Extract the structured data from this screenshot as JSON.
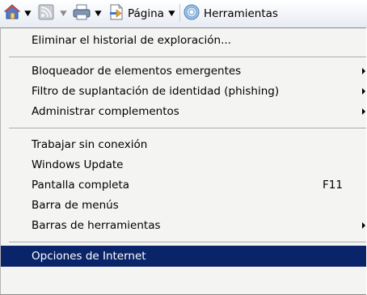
{
  "toolbar": {
    "home_icon": "home-icon",
    "feeds_icon": "feeds-icon",
    "print_icon": "print-icon",
    "page_label": "Página",
    "tools_label": "Herramientas",
    "colors": {
      "blue": "#3a6cc2",
      "orange": "#e38a1a",
      "highlight": "#0a246a"
    }
  },
  "menu": {
    "items": [
      {
        "label": "Eliminar el historial de exploración..."
      },
      {
        "label": "Bloqueador de elementos emergentes"
      },
      {
        "label": "Filtro de suplantación de identidad (phishing)"
      },
      {
        "label": "Administrar complementos"
      },
      {
        "label": "Trabajar sin conexión"
      },
      {
        "label": "Windows Update"
      },
      {
        "label": "Pantalla completa",
        "shortcut": "F11"
      },
      {
        "label": "Barra de menús"
      },
      {
        "label": "Barras de herramientas"
      },
      {
        "label": "Opciones de Internet"
      }
    ]
  }
}
